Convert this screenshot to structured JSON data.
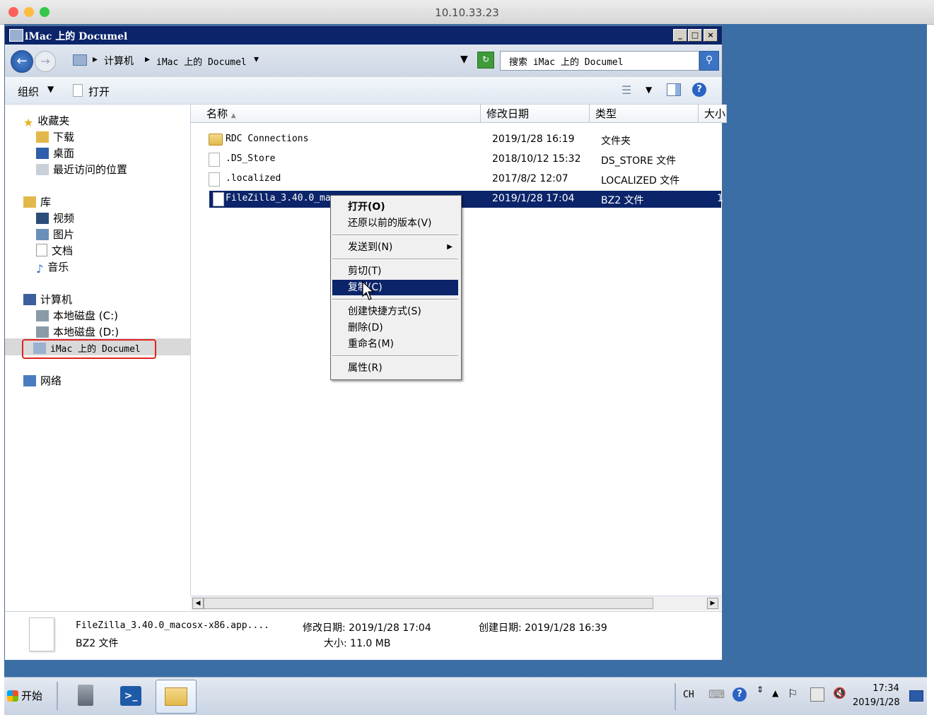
{
  "mac": {
    "title": "10.10.33.23"
  },
  "window": {
    "title": "iMac 上的 Documel",
    "min_label": "_",
    "max_label": "□",
    "close_label": "×"
  },
  "address": {
    "breadcrumb": [
      "计算机",
      "iMac 上的 Documel"
    ],
    "search_placeholder": "搜索 iMac 上的 Documel"
  },
  "toolbar": {
    "organize": "组织",
    "open": "打开"
  },
  "nav": {
    "favorites": "收藏夹",
    "downloads": "下载",
    "desktop": "桌面",
    "recent": "最近访问的位置",
    "libraries": "库",
    "videos": "视频",
    "pictures": "图片",
    "documents": "文档",
    "music": "音乐",
    "computer": "计算机",
    "disk_c": "本地磁盘 (C:)",
    "disk_d": "本地磁盘 (D:)",
    "imac_share": "iMac 上的 Documel",
    "network": "网络"
  },
  "columns": {
    "name": "名称",
    "modified": "修改日期",
    "type": "类型",
    "size": "大小"
  },
  "files": [
    {
      "name": "RDC Connections",
      "modified": "2019/1/28 16:19",
      "type": "文件夹",
      "size": "",
      "kind": "folder"
    },
    {
      "name": ".DS_Store",
      "modified": "2018/10/12 15:32",
      "type": "DS_STORE 文件",
      "size": "",
      "kind": "file"
    },
    {
      "name": ".localized",
      "modified": "2017/8/2 12:07",
      "type": "LOCALIZED 文件",
      "size": "",
      "kind": "file"
    },
    {
      "name": "FileZilla_3.40.0_ma",
      "modified": "2019/1/28 17:04",
      "type": "BZ2 文件",
      "size": "1",
      "kind": "file",
      "selected": true
    }
  ],
  "context_menu": {
    "open": "打开(O)",
    "restore": "还原以前的版本(V)",
    "send_to": "发送到(N)",
    "cut": "剪切(T)",
    "copy": "复制(C)",
    "shortcut": "创建快捷方式(S)",
    "delete": "删除(D)",
    "rename": "重命名(M)",
    "properties": "属性(R)"
  },
  "details": {
    "filename": "FileZilla_3.40.0_macosx-x86.app....",
    "filetype": "BZ2 文件",
    "modified": "修改日期: 2019/1/28 17:04",
    "size": "大小: 11.0 MB",
    "created": "创建日期: 2019/1/28 16:39"
  },
  "taskbar": {
    "start": "开始",
    "lang": "CH",
    "time": "17:34",
    "date": "2019/1/28"
  },
  "colors": {
    "selection": "#0b246a",
    "desktop": "#3a6ea5",
    "highlight_box": "#e0231e"
  }
}
